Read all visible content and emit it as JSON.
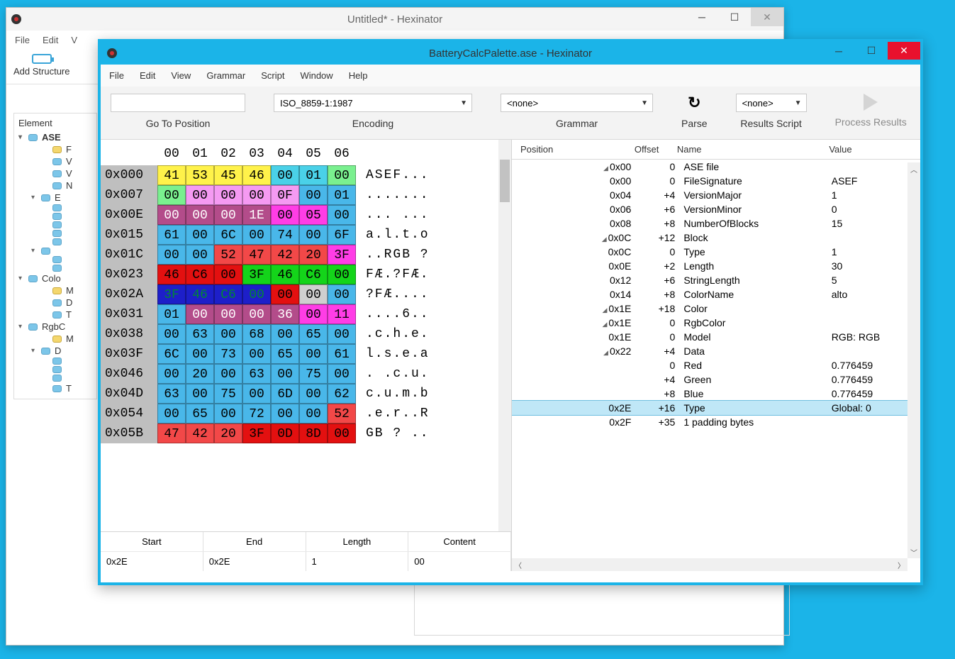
{
  "back_window": {
    "title": "Untitled* - Hexinator",
    "menus": [
      "File",
      "Edit",
      "V"
    ],
    "toolbar": {
      "add_structure": "Add Structure"
    },
    "sidebar_header": "Element",
    "sidebar": [
      {
        "label": "ASE",
        "bold": true,
        "caret": "▾",
        "indent": 0
      },
      {
        "label": "F",
        "indent": 2,
        "y": true
      },
      {
        "label": "V",
        "indent": 2
      },
      {
        "label": "V",
        "indent": 2
      },
      {
        "label": "N",
        "indent": 2
      },
      {
        "label": "E",
        "indent": 1,
        "caret": "▾"
      },
      {
        "label": "",
        "indent": 2
      },
      {
        "label": "",
        "indent": 2
      },
      {
        "label": "",
        "indent": 2
      },
      {
        "label": "",
        "indent": 2
      },
      {
        "label": "",
        "indent": 2
      },
      {
        "label": "",
        "indent": 1,
        "caret": "▾"
      },
      {
        "label": "",
        "indent": 2
      },
      {
        "label": "",
        "indent": 2
      },
      {
        "label": "Colo",
        "indent": 0,
        "caret": "▾"
      },
      {
        "label": "M",
        "indent": 2,
        "y": true
      },
      {
        "label": "D",
        "indent": 2
      },
      {
        "label": "T",
        "indent": 2
      },
      {
        "label": "RgbC",
        "indent": 0,
        "caret": "▾"
      },
      {
        "label": "M",
        "indent": 2,
        "y": true
      },
      {
        "label": "D",
        "indent": 1,
        "caret": "▾"
      },
      {
        "label": "",
        "indent": 2
      },
      {
        "label": "",
        "indent": 2
      },
      {
        "label": "",
        "indent": 2
      },
      {
        "label": "T",
        "indent": 2
      }
    ]
  },
  "front_window": {
    "title": "BatteryCalcPalette.ase - Hexinator",
    "menus": [
      "File",
      "Edit",
      "View",
      "Grammar",
      "Script",
      "Window",
      "Help"
    ],
    "toolbar": {
      "goto_label": "Go To Position",
      "encoding_value": "ISO_8859-1:1987",
      "encoding_label": "Encoding",
      "grammar_value": "<none>",
      "grammar_label": "Grammar",
      "parse_label": "Parse",
      "results_script_value": "<none>",
      "results_script_label": "Results Script",
      "process_label": "Process Results"
    },
    "hex_header": [
      "00",
      "01",
      "02",
      "03",
      "04",
      "05",
      "06"
    ],
    "hex_rows": [
      {
        "addr": "0x000",
        "bytes": [
          {
            "v": "41",
            "bg": "#fff24a"
          },
          {
            "v": "53",
            "bg": "#fff24a"
          },
          {
            "v": "45",
            "bg": "#fff24a"
          },
          {
            "v": "46",
            "bg": "#fff24a"
          },
          {
            "v": "00",
            "bg": "#4ad1e8"
          },
          {
            "v": "01",
            "bg": "#4ad1e8"
          },
          {
            "v": "00",
            "bg": "#7af08f"
          }
        ],
        "ascii": "ASEF..."
      },
      {
        "addr": "0x007",
        "bytes": [
          {
            "v": "00",
            "bg": "#7af08f"
          },
          {
            "v": "00",
            "bg": "#f59af2"
          },
          {
            "v": "00",
            "bg": "#f59af2"
          },
          {
            "v": "00",
            "bg": "#f59af2"
          },
          {
            "v": "0F",
            "bg": "#f59af2"
          },
          {
            "v": "00",
            "bg": "#49b7e9"
          },
          {
            "v": "01",
            "bg": "#49b7e9"
          }
        ],
        "ascii": "......."
      },
      {
        "addr": "0x00E",
        "bytes": [
          {
            "v": "00",
            "bg": "#b34c8a",
            "fg": "#fff"
          },
          {
            "v": "00",
            "bg": "#b34c8a",
            "fg": "#fff"
          },
          {
            "v": "00",
            "bg": "#b34c8a",
            "fg": "#fff"
          },
          {
            "v": "1E",
            "bg": "#b34c8a",
            "fg": "#fff"
          },
          {
            "v": "00",
            "bg": "#ff3de6"
          },
          {
            "v": "05",
            "bg": "#ff3de6"
          },
          {
            "v": "00",
            "bg": "#49b7e9"
          }
        ],
        "ascii": "... ..."
      },
      {
        "addr": "0x015",
        "bytes": [
          {
            "v": "61",
            "bg": "#49b7e9"
          },
          {
            "v": "00",
            "bg": "#49b7e9"
          },
          {
            "v": "6C",
            "bg": "#49b7e9"
          },
          {
            "v": "00",
            "bg": "#49b7e9"
          },
          {
            "v": "74",
            "bg": "#49b7e9"
          },
          {
            "v": "00",
            "bg": "#49b7e9"
          },
          {
            "v": "6F",
            "bg": "#49b7e9"
          }
        ],
        "ascii": "a.l.t.o"
      },
      {
        "addr": "0x01C",
        "bytes": [
          {
            "v": "00",
            "bg": "#49b7e9"
          },
          {
            "v": "00",
            "bg": "#49b7e9"
          },
          {
            "v": "52",
            "bg": "#f24848"
          },
          {
            "v": "47",
            "bg": "#f24848"
          },
          {
            "v": "42",
            "bg": "#f24848"
          },
          {
            "v": "20",
            "bg": "#f24848"
          },
          {
            "v": "3F",
            "bg": "#ff3de6"
          }
        ],
        "ascii": "..RGB ?"
      },
      {
        "addr": "0x023",
        "bytes": [
          {
            "v": "46",
            "bg": "#e31010",
            "fg": "#000"
          },
          {
            "v": "C6",
            "bg": "#e31010",
            "fg": "#000"
          },
          {
            "v": "00",
            "bg": "#e31010",
            "fg": "#000"
          },
          {
            "v": "3F",
            "bg": "#14d41a"
          },
          {
            "v": "46",
            "bg": "#14d41a"
          },
          {
            "v": "C6",
            "bg": "#14d41a"
          },
          {
            "v": "00",
            "bg": "#14d41a"
          }
        ],
        "ascii": "FÆ.?FÆ."
      },
      {
        "addr": "0x02A",
        "bytes": [
          {
            "v": "3F",
            "bg": "#1d1fc9",
            "fg": "#083"
          },
          {
            "v": "46",
            "bg": "#1d1fc9",
            "fg": "#083"
          },
          {
            "v": "C6",
            "bg": "#1d1fc9",
            "fg": "#083"
          },
          {
            "v": "00",
            "bg": "#1d1fc9",
            "fg": "#083"
          },
          {
            "v": "00",
            "bg": "#e31010"
          },
          {
            "v": "00",
            "bg": "#cfcfcf"
          },
          {
            "v": "00",
            "bg": "#49b7e9"
          }
        ],
        "ascii": "?FÆ...."
      },
      {
        "addr": "0x031",
        "bytes": [
          {
            "v": "01",
            "bg": "#49b7e9"
          },
          {
            "v": "00",
            "bg": "#b34c8a",
            "fg": "#fff"
          },
          {
            "v": "00",
            "bg": "#b34c8a",
            "fg": "#fff"
          },
          {
            "v": "00",
            "bg": "#b34c8a",
            "fg": "#fff"
          },
          {
            "v": "36",
            "bg": "#b34c8a",
            "fg": "#fff"
          },
          {
            "v": "00",
            "bg": "#ff3de6"
          },
          {
            "v": "11",
            "bg": "#ff3de6"
          }
        ],
        "ascii": "....6.."
      },
      {
        "addr": "0x038",
        "bytes": [
          {
            "v": "00",
            "bg": "#49b7e9"
          },
          {
            "v": "63",
            "bg": "#49b7e9"
          },
          {
            "v": "00",
            "bg": "#49b7e9"
          },
          {
            "v": "68",
            "bg": "#49b7e9"
          },
          {
            "v": "00",
            "bg": "#49b7e9"
          },
          {
            "v": "65",
            "bg": "#49b7e9"
          },
          {
            "v": "00",
            "bg": "#49b7e9"
          }
        ],
        "ascii": ".c.h.e."
      },
      {
        "addr": "0x03F",
        "bytes": [
          {
            "v": "6C",
            "bg": "#49b7e9"
          },
          {
            "v": "00",
            "bg": "#49b7e9"
          },
          {
            "v": "73",
            "bg": "#49b7e9"
          },
          {
            "v": "00",
            "bg": "#49b7e9"
          },
          {
            "v": "65",
            "bg": "#49b7e9"
          },
          {
            "v": "00",
            "bg": "#49b7e9"
          },
          {
            "v": "61",
            "bg": "#49b7e9"
          }
        ],
        "ascii": "l.s.e.a"
      },
      {
        "addr": "0x046",
        "bytes": [
          {
            "v": "00",
            "bg": "#49b7e9"
          },
          {
            "v": "20",
            "bg": "#49b7e9"
          },
          {
            "v": "00",
            "bg": "#49b7e9"
          },
          {
            "v": "63",
            "bg": "#49b7e9"
          },
          {
            "v": "00",
            "bg": "#49b7e9"
          },
          {
            "v": "75",
            "bg": "#49b7e9"
          },
          {
            "v": "00",
            "bg": "#49b7e9"
          }
        ],
        "ascii": ". .c.u."
      },
      {
        "addr": "0x04D",
        "bytes": [
          {
            "v": "63",
            "bg": "#49b7e9"
          },
          {
            "v": "00",
            "bg": "#49b7e9"
          },
          {
            "v": "75",
            "bg": "#49b7e9"
          },
          {
            "v": "00",
            "bg": "#49b7e9"
          },
          {
            "v": "6D",
            "bg": "#49b7e9"
          },
          {
            "v": "00",
            "bg": "#49b7e9"
          },
          {
            "v": "62",
            "bg": "#49b7e9"
          }
        ],
        "ascii": "c.u.m.b"
      },
      {
        "addr": "0x054",
        "bytes": [
          {
            "v": "00",
            "bg": "#49b7e9"
          },
          {
            "v": "65",
            "bg": "#49b7e9"
          },
          {
            "v": "00",
            "bg": "#49b7e9"
          },
          {
            "v": "72",
            "bg": "#49b7e9"
          },
          {
            "v": "00",
            "bg": "#49b7e9"
          },
          {
            "v": "00",
            "bg": "#49b7e9"
          },
          {
            "v": "52",
            "bg": "#f24848"
          }
        ],
        "ascii": ".e.r..R"
      },
      {
        "addr": "0x05B",
        "bytes": [
          {
            "v": "47",
            "bg": "#f24848"
          },
          {
            "v": "42",
            "bg": "#f24848"
          },
          {
            "v": "20",
            "bg": "#f24848"
          },
          {
            "v": "3F",
            "bg": "#e31010"
          },
          {
            "v": "0D",
            "bg": "#e31010"
          },
          {
            "v": "8D",
            "bg": "#e31010"
          },
          {
            "v": "00",
            "bg": "#e31010"
          }
        ],
        "ascii": "GB ? .."
      }
    ],
    "selection": {
      "headers": [
        "Start",
        "End",
        "Length",
        "Content"
      ],
      "values": [
        "0x2E",
        "0x2E",
        "1",
        "00"
      ]
    },
    "results_header": {
      "pos": "Position",
      "off": "Offset",
      "name": "Name",
      "val": "Value"
    },
    "results": [
      {
        "tri": 1,
        "pos": "0x00",
        "off": "0",
        "name": "ASE file",
        "val": ""
      },
      {
        "pos": "0x00",
        "off": "0",
        "name": "FileSignature",
        "val": "ASEF"
      },
      {
        "pos": "0x04",
        "off": "+4",
        "name": "VersionMajor",
        "val": "1"
      },
      {
        "pos": "0x06",
        "off": "+6",
        "name": "VersionMinor",
        "val": "0"
      },
      {
        "pos": "0x08",
        "off": "+8",
        "name": "NumberOfBlocks",
        "val": "15"
      },
      {
        "tri": 2,
        "pos": "0x0C",
        "off": "+12",
        "name": "Block",
        "val": ""
      },
      {
        "pos": "0x0C",
        "off": "0",
        "name": "Type",
        "val": "1"
      },
      {
        "pos": "0x0E",
        "off": "+2",
        "name": "Length",
        "val": "30"
      },
      {
        "pos": "0x12",
        "off": "+6",
        "name": "StringLength",
        "val": "5"
      },
      {
        "pos": "0x14",
        "off": "+8",
        "name": "ColorName",
        "val": "alto"
      },
      {
        "tri": 3,
        "pos": "0x1E",
        "off": "+18",
        "name": "Color",
        "val": ""
      },
      {
        "tri": 4,
        "pos": "0x1E",
        "off": "0",
        "name": "RgbColor",
        "val": ""
      },
      {
        "pos": "0x1E",
        "off": "0",
        "name": "Model",
        "val": "RGB: RGB"
      },
      {
        "tri": 5,
        "pos": "0x22",
        "off": "+4",
        "name": "Data",
        "val": ""
      },
      {
        "pos": "",
        "off": "0",
        "name": "Red",
        "val": "0.776459"
      },
      {
        "pos": "",
        "off": "+4",
        "name": "Green",
        "val": "0.776459"
      },
      {
        "pos": "",
        "off": "+8",
        "name": "Blue",
        "val": "0.776459"
      },
      {
        "sel": true,
        "pos": "0x2E",
        "off": "+16",
        "name": "Type",
        "val": "Global: 0"
      },
      {
        "pos": "0x2F",
        "off": "+35",
        "name": "1 padding bytes",
        "val": ""
      }
    ]
  }
}
